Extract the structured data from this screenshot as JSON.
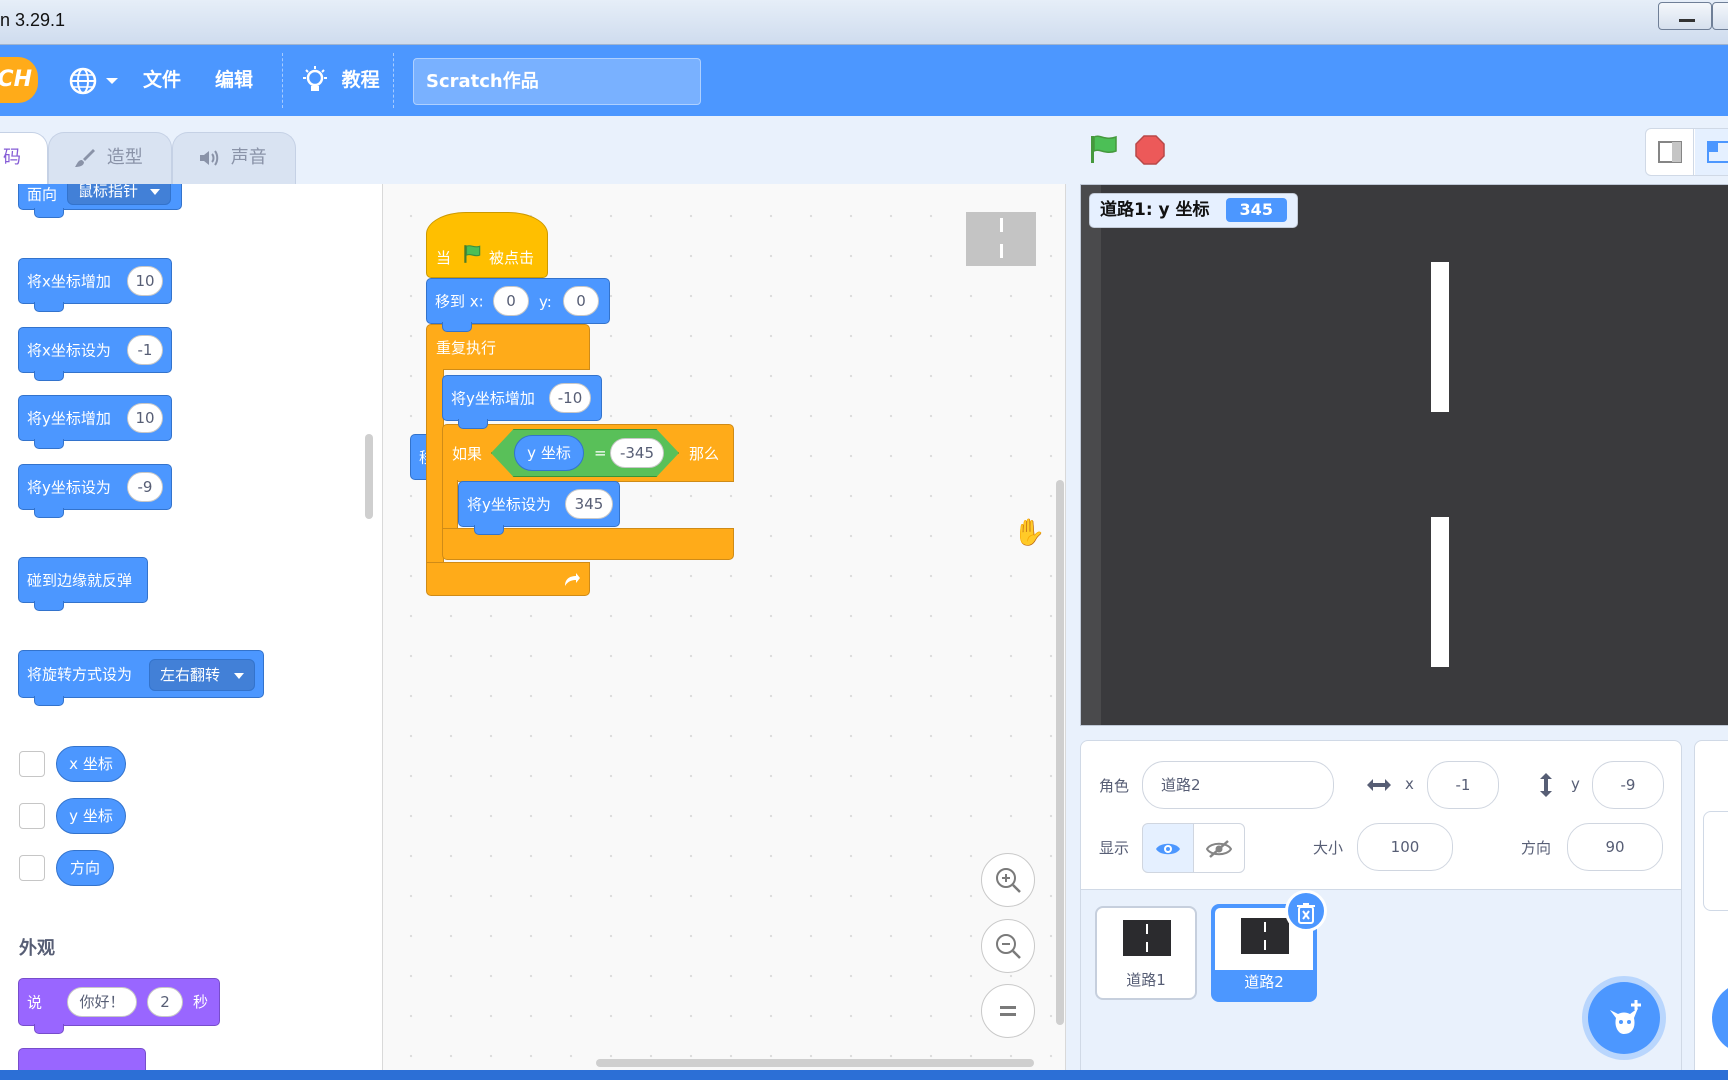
{
  "window": {
    "title": "n 3.29.1"
  },
  "menubar": {
    "logo": "TCH",
    "file": "文件",
    "edit": "编辑",
    "tutorial": "教程",
    "project_title": "Scratch作品"
  },
  "tabs": {
    "code": "码",
    "costumes": "造型",
    "sounds": "声音"
  },
  "palette": {
    "point_towards": "面向",
    "point_towards_value": "鼠标指针",
    "change_x": "将x坐标增加",
    "change_x_value": "10",
    "set_x": "将x坐标设为",
    "set_x_value": "-1",
    "change_y": "将y坐标增加",
    "change_y_value": "10",
    "set_y": "将y坐标设为",
    "set_y_value": "-9",
    "bounce": "碰到边缘就反弹",
    "rotation_style": "将旋转方式设为",
    "rotation_style_value": "左右翻转",
    "x_position": "x 坐标",
    "y_position": "y 坐标",
    "direction": "方向",
    "looks_heading": "外观",
    "say": "说",
    "say_text": "你好！",
    "say_secs": "2",
    "say_unit": "秒"
  },
  "script": {
    "hat_when": "当",
    "hat_clicked": "被点击",
    "goto_label": "移到 x:",
    "goto_x": "0",
    "goto_y_label": "y:",
    "goto_y": "0",
    "forever": "重复执行",
    "change_y": "将y坐标增加",
    "change_y_value": "-10",
    "if": "如果",
    "condition_reporter": "y 坐标",
    "equals": "=",
    "condition_value": "-345",
    "then": "那么",
    "set_y": "将y坐标设为",
    "set_y_value": "345",
    "stray_block": "移"
  },
  "stage": {
    "monitor_label": "道路1: y 坐标",
    "monitor_value": "345"
  },
  "sprite_info": {
    "sprite_label": "角色",
    "sprite_name": "道路2",
    "x_label": "x",
    "x_value": "-1",
    "y_label": "y",
    "y_value": "-9",
    "show_label": "显示",
    "size_label": "大小",
    "size_value": "100",
    "direction_label": "方向",
    "direction_value": "90"
  },
  "sprites": [
    {
      "name": "道路1",
      "selected": false
    },
    {
      "name": "道路2",
      "selected": true
    }
  ],
  "colors": {
    "accent": "#4c97ff",
    "motion": "#4c97ff",
    "events": "#ffbf00",
    "control": "#ffab19",
    "operators": "#59c059",
    "looks": "#9966ff"
  }
}
